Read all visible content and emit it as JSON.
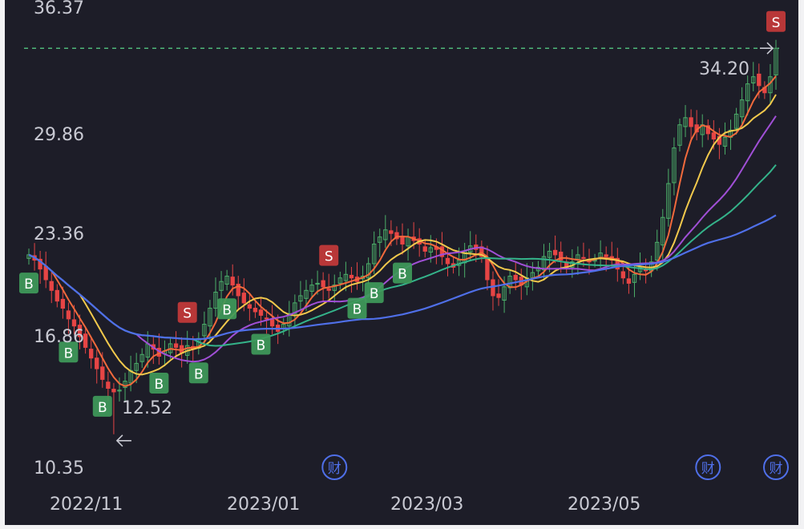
{
  "chart_data": {
    "type": "candlestick",
    "y_ticks": [
      "36.37",
      "29.86",
      "23.36",
      "16.86",
      "10.35"
    ],
    "ylim": [
      10.35,
      36.37
    ],
    "x_ticks": [
      "2022/11",
      "2023/01",
      "2023/03",
      "2023/05"
    ],
    "annotations": {
      "last_price": "34.20",
      "low_price": "12.52",
      "earnings_label": "财",
      "buy_label": "B",
      "sell_label": "S"
    },
    "candles": {
      "start_close": 22.6,
      "closes": [
        22.6,
        22.3,
        21.8,
        21.2,
        20.6,
        20.0,
        19.6,
        19.0,
        18.6,
        18.0,
        17.4,
        16.8,
        16.2,
        15.6,
        15.1,
        14.9,
        15.0,
        15.5,
        16.1,
        16.5,
        17.0,
        17.6,
        17.3,
        16.9,
        17.2,
        17.6,
        17.4,
        17.1,
        17.5,
        17.3,
        17.9,
        18.7,
        19.6,
        20.5,
        21.1,
        21.4,
        20.9,
        20.3,
        19.9,
        19.6,
        19.4,
        19.2,
        19.0,
        18.6,
        18.3,
        18.7,
        19.3,
        19.9,
        20.3,
        20.6,
        20.9,
        21.0,
        20.8,
        20.6,
        20.9,
        21.3,
        21.5,
        21.3,
        21.1,
        21.4,
        22.1,
        23.2,
        23.6,
        24.0,
        23.8,
        23.5,
        23.2,
        23.6,
        23.4,
        23.2,
        22.8,
        23.0,
        22.9,
        22.5,
        22.1,
        21.9,
        22.3,
        22.8,
        23.1,
        22.9,
        22.5,
        21.2,
        20.3,
        20.2,
        20.8,
        21.4,
        21.2,
        20.9,
        21.3,
        21.6,
        21.9,
        22.5,
        22.8,
        22.6,
        22.3,
        21.9,
        22.2,
        22.6,
        22.4,
        22.2,
        22.3,
        22.7,
        22.5,
        22.3,
        21.8,
        21.3,
        21.0,
        21.5,
        21.9,
        21.7,
        22.2,
        23.3,
        24.7,
        26.6,
        28.6,
        29.9,
        30.3,
        29.8,
        29.5,
        29.9,
        29.4,
        29.1,
        28.8,
        29.2,
        29.6,
        30.5,
        31.3,
        32.2,
        32.6,
        32.1,
        31.7,
        32.6,
        34.2
      ],
      "sample_every": 1,
      "earnings_days": [
        54,
        120,
        176
      ]
    },
    "series": [
      {
        "key": "ma5",
        "color": "#f26a3c"
      },
      {
        "key": "ma10",
        "color": "#f2c94c"
      },
      {
        "key": "ma20",
        "color": "#a04fd6"
      },
      {
        "key": "ma30",
        "color": "#34b38a"
      },
      {
        "key": "ma60",
        "color": "#4f6fe8"
      }
    ],
    "signals": [
      {
        "type": "B",
        "day": 0
      },
      {
        "type": "B",
        "day": 7
      },
      {
        "type": "B",
        "day": 13
      },
      {
        "type": "B",
        "day": 23
      },
      {
        "type": "B",
        "day": 30
      },
      {
        "type": "B",
        "day": 35
      },
      {
        "type": "B",
        "day": 41
      },
      {
        "type": "S",
        "day": 28
      },
      {
        "type": "S",
        "day": 53
      },
      {
        "type": "B",
        "day": 58
      },
      {
        "type": "B",
        "day": 61
      },
      {
        "type": "B",
        "day": 66
      },
      {
        "type": "S",
        "day": 167
      }
    ],
    "colors": {
      "up": "#4caf6a",
      "down": "#e64545",
      "buy": "#3f9a5a",
      "sell": "#c63a3a",
      "dashed": "#4fb87a",
      "earnings": "#4f6fe8"
    }
  }
}
